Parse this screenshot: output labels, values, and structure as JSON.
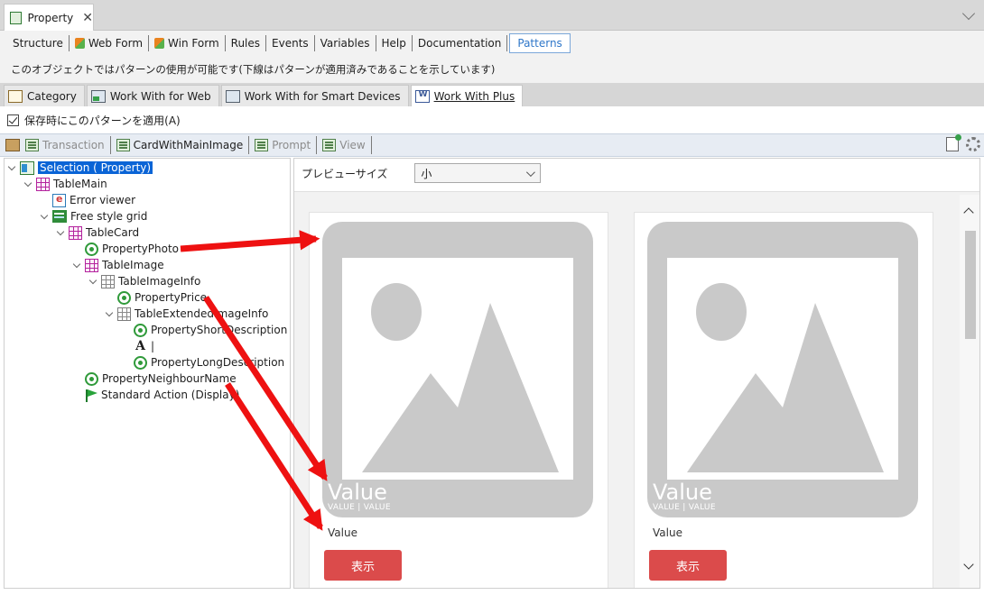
{
  "document_tab": {
    "title": "Property",
    "close": "✕"
  },
  "subtabs": [
    {
      "label": "Structure"
    },
    {
      "label": "Web Form"
    },
    {
      "label": "Win Form"
    },
    {
      "label": "Rules"
    },
    {
      "label": "Events"
    },
    {
      "label": "Variables"
    },
    {
      "label": "Help"
    },
    {
      "label": "Documentation"
    },
    {
      "label": "Patterns"
    }
  ],
  "info_text": "このオブジェクトではパターンの使用が可能です(下線はパターンが適用済みであることを示しています)",
  "pattern_tabs": [
    {
      "label": "Category"
    },
    {
      "label": "Work With for Web"
    },
    {
      "label": "Work With for Smart Devices"
    },
    {
      "label": "Work With Plus"
    }
  ],
  "apply_on_save": {
    "label": "保存時にこのパターンを適用(A)",
    "checked": true
  },
  "inner_toolbar": [
    {
      "label": "Transaction"
    },
    {
      "label": "CardWithMainImage"
    },
    {
      "label": "Prompt"
    },
    {
      "label": "View"
    }
  ],
  "tree": [
    {
      "label": "Selection ( Property)",
      "icon": "selection-icon"
    },
    {
      "label": "TableMain",
      "icon": "table-icon"
    },
    {
      "label": "Error viewer",
      "icon": "error-viewer-icon"
    },
    {
      "label": "Free style grid",
      "icon": "grid-icon"
    },
    {
      "label": "TableCard",
      "icon": "table-icon"
    },
    {
      "label": "PropertyPhoto",
      "icon": "attribute-icon"
    },
    {
      "label": "TableImage",
      "icon": "table-icon"
    },
    {
      "label": "TableImageInfo",
      "icon": "table-icon"
    },
    {
      "label": "PropertyPrice",
      "icon": "attribute-icon"
    },
    {
      "label": "TableExtendedImageInfo",
      "icon": "table-icon"
    },
    {
      "label": "PropertyShortDescription",
      "icon": "attribute-icon"
    },
    {
      "label": "|",
      "icon": "text-block-icon"
    },
    {
      "label": "PropertyLongDescription",
      "icon": "attribute-icon"
    },
    {
      "label": "PropertyNeighbourName",
      "icon": "attribute-icon"
    },
    {
      "label": "Standard Action (Display)",
      "icon": "flag-icon"
    }
  ],
  "preview": {
    "size_label": "プレビューサイズ",
    "size_value": "小",
    "cards": [
      {
        "value_big": "Value",
        "sub": "VALUE | VALUE",
        "value": "Value",
        "button": "表示"
      },
      {
        "value_big": "Value",
        "sub": "VALUE | VALUE",
        "value": "Value",
        "button": "表示"
      }
    ]
  },
  "colors": {
    "selection": "#0a64d6",
    "button": "#db4b4b",
    "arrow": "#ee1111",
    "active_tab": "#2f77c9"
  }
}
